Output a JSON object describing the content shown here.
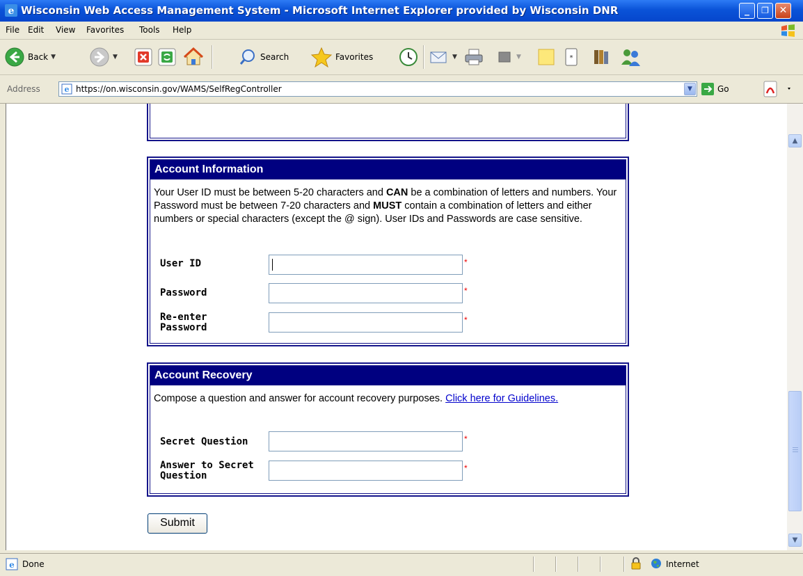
{
  "window": {
    "title": "Wisconsin Web Access Management System - Microsoft Internet Explorer provided by Wisconsin DNR",
    "min_glyph": "_",
    "max_glyph": "❐",
    "close_glyph": "✕"
  },
  "menu": [
    "File",
    "Edit",
    "View",
    "Favorites",
    "Tools",
    "Help"
  ],
  "toolbar": {
    "back_label": "Back",
    "search_label": "Search",
    "favorites_label": "Favorites"
  },
  "address": {
    "label": "Address",
    "url": "https://on.wisconsin.gov/WAMS/SelfRegController",
    "go_label": "Go"
  },
  "account_info": {
    "heading": "Account Information",
    "desc_1": "Your User ID must be between 5-20 characters and ",
    "desc_can": "CAN",
    "desc_2": " be a combination of letters and numbers. Your Password must be between 7-20 characters and ",
    "desc_must": "MUST",
    "desc_3": " contain a combination of letters and either numbers or special characters (except the @ sign). User IDs and Passwords are case sensitive.",
    "fields": [
      {
        "label": "User ID",
        "value": "",
        "required_mark": "*"
      },
      {
        "label": "Password",
        "value": "",
        "required_mark": "*"
      },
      {
        "label": "Re-enter Password",
        "value": "",
        "required_mark": "*"
      }
    ]
  },
  "account_recovery": {
    "heading": "Account Recovery",
    "desc": "Compose a question and answer for account recovery purposes. ",
    "link": "Click here for Guidelines.",
    "fields": [
      {
        "label": "Secret Question",
        "value": "",
        "required_mark": "*"
      },
      {
        "label": "Answer to Secret Question",
        "value": "",
        "required_mark": "*"
      }
    ]
  },
  "submit_label": "Submit",
  "status": {
    "text": "Done",
    "zone": "Internet"
  },
  "colors": {
    "panel_header": "#000080",
    "titlebar": "#0a53d8",
    "required": "#ee0000"
  }
}
